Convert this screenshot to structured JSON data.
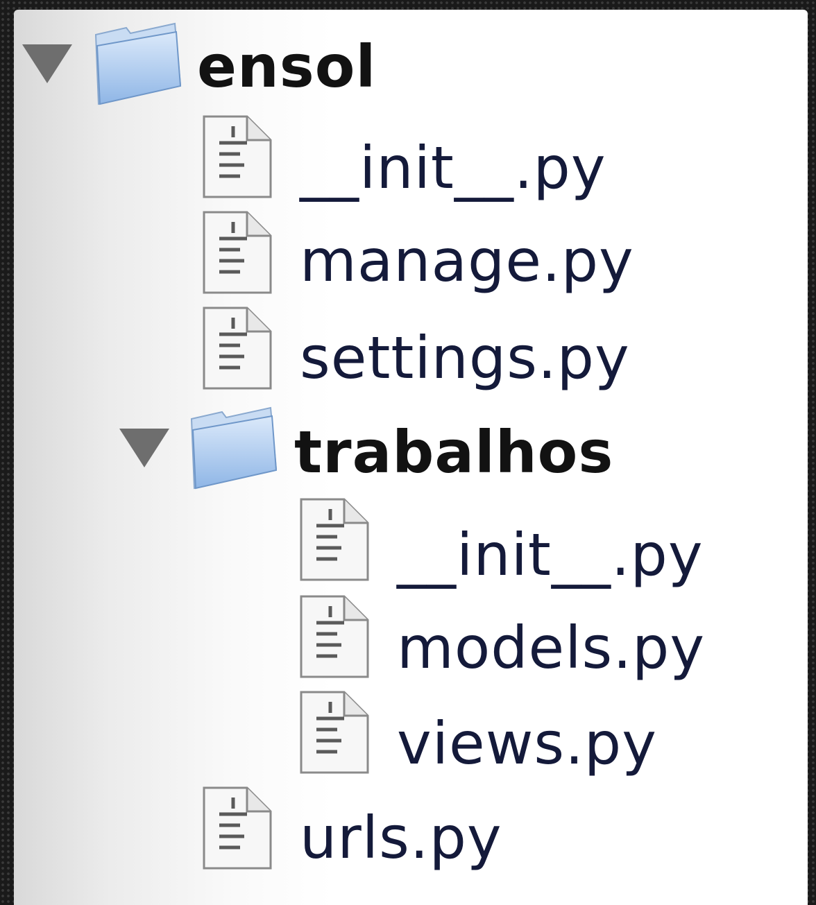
{
  "tree": {
    "root": {
      "label": "ensol",
      "expanded": true,
      "children": [
        {
          "label": "__init__.py"
        },
        {
          "label": "manage.py"
        },
        {
          "label": "settings.py"
        },
        {
          "label": "trabalhos",
          "expanded": true,
          "children": [
            {
              "label": "__init__.py"
            },
            {
              "label": "models.py"
            },
            {
              "label": "views.py"
            }
          ]
        },
        {
          "label": "urls.py"
        }
      ]
    }
  },
  "icons": {
    "folder": "folder-icon",
    "file": "python-file-icon",
    "disclosure": "disclosure-triangle-icon"
  },
  "colors": {
    "folder_blue": "#a9c9ee",
    "disclosure_gray": "#6e6e6e",
    "text_dark": "#141a3a"
  }
}
